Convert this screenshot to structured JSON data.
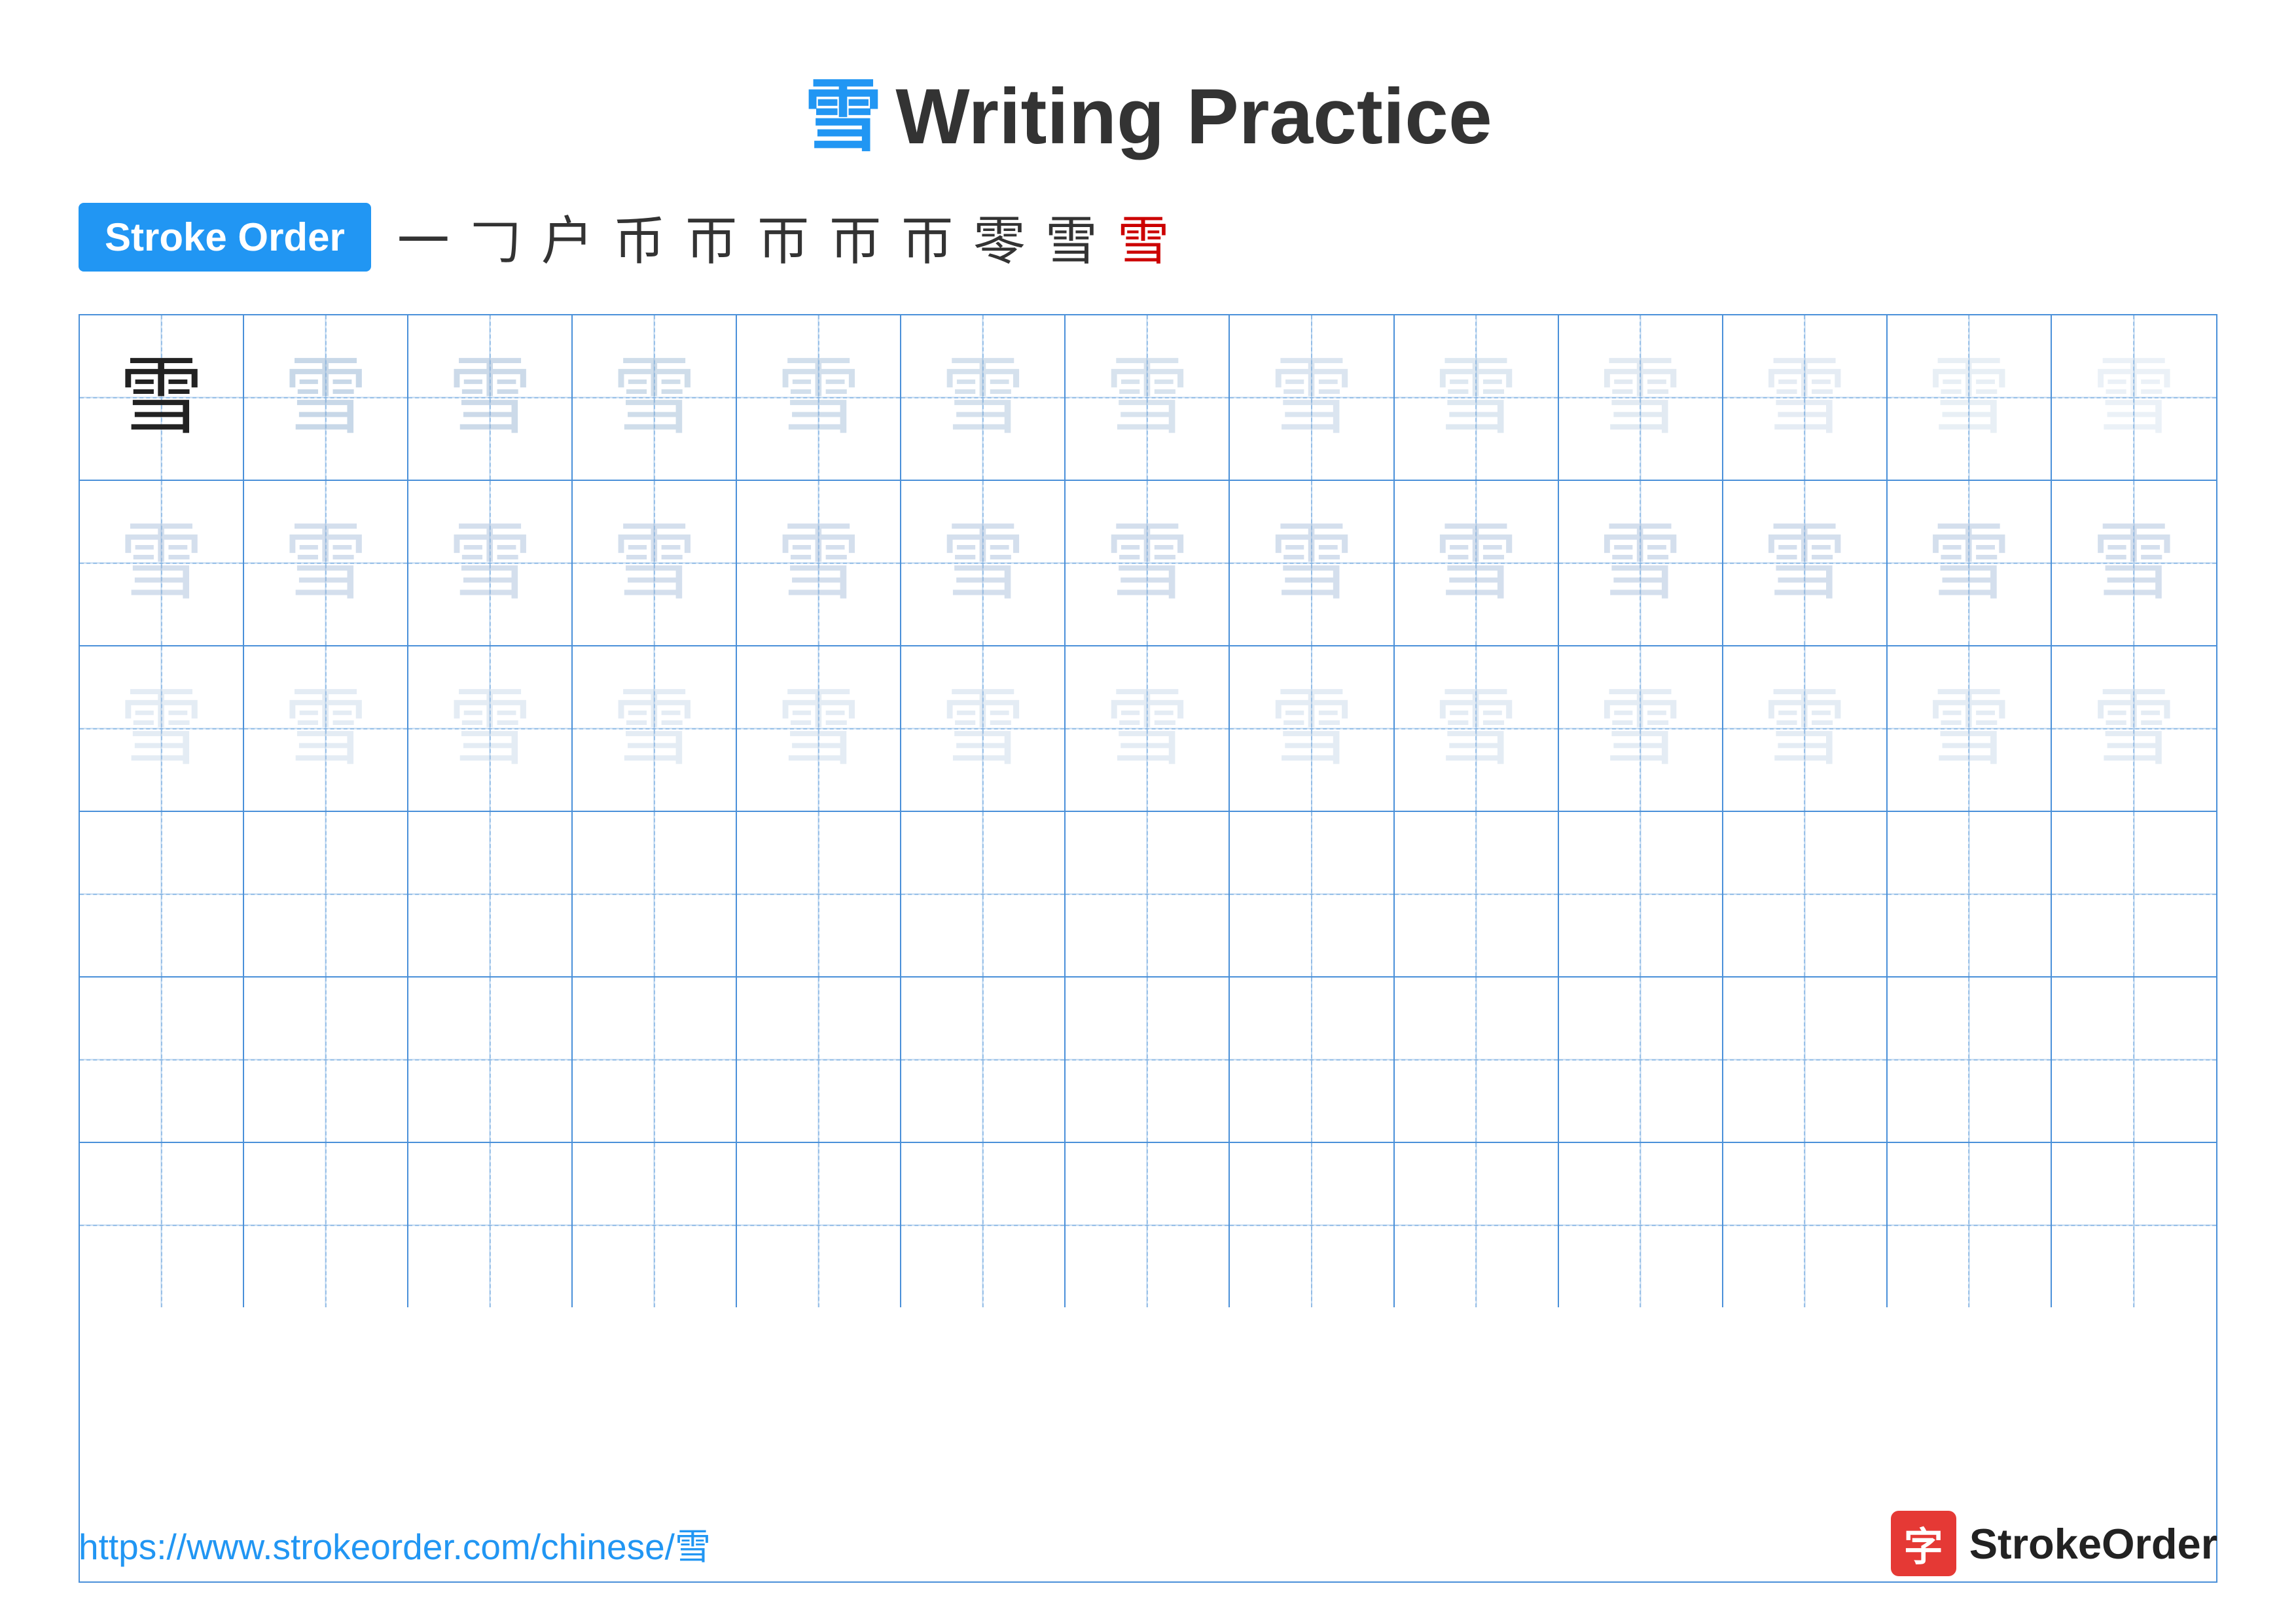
{
  "title": {
    "char": "雪",
    "text": "Writing Practice"
  },
  "stroke_order": {
    "badge_label": "Stroke Order",
    "steps": [
      "一",
      "𠃌",
      "户",
      "币",
      "帀",
      "帀",
      "帀",
      "帀",
      "零",
      "雪",
      "雪"
    ]
  },
  "grid": {
    "rows": 6,
    "cols": 13,
    "char": "雪"
  },
  "footer": {
    "url": "https://www.strokeorder.com/chinese/雪",
    "logo_char": "字",
    "logo_text": "StrokeOrder"
  }
}
